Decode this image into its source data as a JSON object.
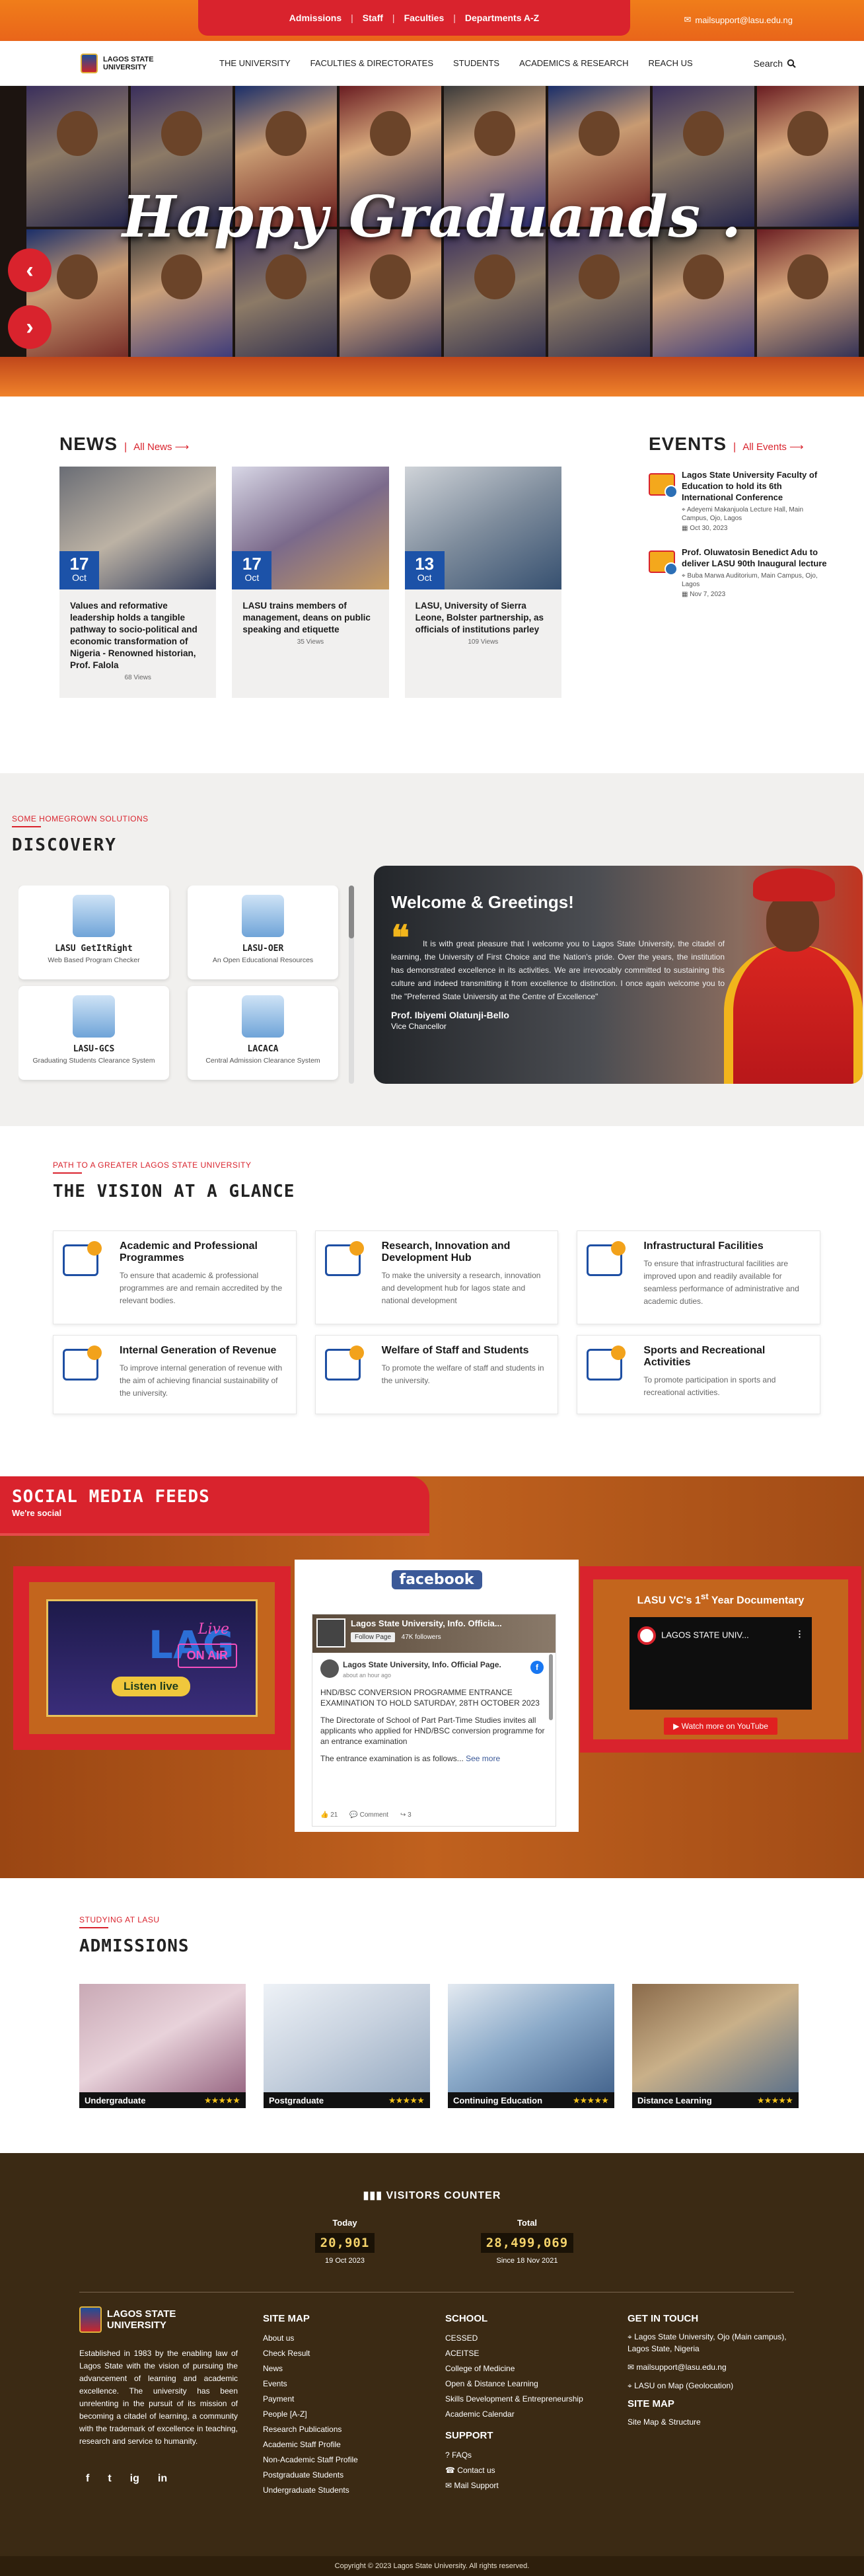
{
  "topbar": {
    "links": [
      "Admissions",
      "Staff",
      "Faculties",
      "Departments A-Z"
    ],
    "email": "mailsupport@lasu.edu.ng"
  },
  "nav": {
    "logo_text": "LAGOS STATE UNIVERSITY",
    "items": [
      "THE UNIVERSITY",
      "FACULTIES & DIRECTORATES",
      "STUDENTS",
      "ACADEMICS & RESEARCH",
      "REACH US"
    ],
    "search_label": "Search"
  },
  "hero": {
    "title": "Happy Graduands .",
    "prev_icon": "chevron-left-icon",
    "next_icon": "chevron-right-icon"
  },
  "news": {
    "heading": "NEWS",
    "all_link": "All News ⟶",
    "items": [
      {
        "day": "17",
        "month": "Oct",
        "title": "Values and reformative leadership holds a tangible pathway to socio-political and economic transformation of Nigeria - Renowned historian, Prof. Falola",
        "views": "68 Views"
      },
      {
        "day": "17",
        "month": "Oct",
        "title": "LASU trains members of management, deans on public speaking and etiquette",
        "views": "35 Views"
      },
      {
        "day": "13",
        "month": "Oct",
        "title": "LASU, University of Sierra Leone, Bolster partnership, as officials of institutions parley",
        "views": "109 Views"
      }
    ]
  },
  "events": {
    "heading": "EVENTS",
    "all_link": "All Events ⟶",
    "items": [
      {
        "title": "Lagos State University Faculty of Education to hold its 6th International Conference",
        "location": "Adeyemi Makanjuola Lecture Hall, Main Campus, Ojo, Lagos",
        "date": "Oct 30, 2023"
      },
      {
        "title": "Prof. Oluwatosin Benedict Adu to deliver LASU 90th Inaugural lecture",
        "location": "Buba Marwa Auditorium, Main Campus, Ojo, Lagos",
        "date": "Nov 7, 2023"
      }
    ]
  },
  "discovery": {
    "kicker": "SOME HOMEGROWN SOLUTIONS",
    "title": "DISCOVERY",
    "tiles": [
      {
        "name": "LASU GetItRight",
        "desc": "Web Based Program Checker"
      },
      {
        "name": "LASU-OER",
        "desc": "An Open Educational Resources"
      },
      {
        "name": "LASU-GCS",
        "desc": "Graduating Students Clearance System"
      },
      {
        "name": "LACACA",
        "desc": "Central Admission Clearance System"
      }
    ]
  },
  "welcome": {
    "title": "Welcome & Greetings!",
    "text": "It is with great pleasure that I welcome you to Lagos State University, the citadel of learning, the University of First Choice and the Nation's pride. Over the years, the institution has demonstrated excellence in its activities. We are irrevocably committed to sustaining this culture and indeed transmitting it from excellence to distinction. I once again welcome you to the \"Preferred State University at the Centre of Excellence\"",
    "name": "Prof. Ibiyemi Olatunji-Bello",
    "role": "Vice Chancellor"
  },
  "vision": {
    "kicker": "PATH TO A GREATER LAGOS STATE UNIVERSITY",
    "title": "THE VISION AT A GLANCE",
    "items": [
      {
        "title": "Academic and Professional Programmes",
        "desc": "To ensure that academic & professional programmes are and remain accredited by the relevant bodies."
      },
      {
        "title": "Research, Innovation and Development Hub",
        "desc": "To make the university a research, innovation and development hub for lagos state and national development"
      },
      {
        "title": "Infrastructural Facilities",
        "desc": "To ensure that infrastructural facilities are improved upon and readily available for seamless performance of administrative and academic duties."
      },
      {
        "title": "Internal Generation of Revenue",
        "desc": "To improve internal generation of revenue with the aim of achieving financial sustainability of the university."
      },
      {
        "title": "Welfare of Staff and Students",
        "desc": "To promote the welfare of staff and students in the university."
      },
      {
        "title": "Sports and Recreational Activities",
        "desc": "To promote participation in sports and recreational activities."
      }
    ]
  },
  "social": {
    "title": "SOCIAL MEDIA FEEDS",
    "subtitle": "We're social",
    "radio": {
      "logo": "LAG",
      "live": "Live",
      "air": "ON AIR",
      "listen": "Listen live"
    },
    "facebook": {
      "brand": "facebook",
      "page": "Lagos State University, Info. Officia...",
      "follow": "Follow Page",
      "followers": "47K followers",
      "post_name": "Lagos State University, Info. Official Page.",
      "post_time": "about an hour ago",
      "post_title": "HND/BSC CONVERSION PROGRAMME ENTRANCE EXAMINATION TO HOLD SATURDAY, 28TH OCTOBER 2023",
      "post_body": "The Directorate of School of Part Part-Time Studies invites all applicants who applied for HND/BSC conversion programme for an entrance examination",
      "post_more": "The entrance examination is as follows...",
      "see_more": "See more",
      "likes": "21",
      "comment": "Comment",
      "shares": "3"
    },
    "youtube": {
      "heading_pre": "LASU VC's 1",
      "heading_sup": "st",
      "heading_post": " Year Documentary",
      "video_title": "LAGOS STATE UNIV...",
      "watch": "Watch more on YouTube"
    }
  },
  "admissions": {
    "kicker": "STUDYING AT LASU",
    "title": "ADMISSIONS",
    "items": [
      {
        "label": "Undergraduate",
        "stars": "★★★★★"
      },
      {
        "label": "Postgraduate",
        "stars": "★★★★★"
      },
      {
        "label": "Continuing Education",
        "stars": "★★★★★"
      },
      {
        "label": "Distance Learning",
        "stars": "★★★★★"
      }
    ]
  },
  "footer": {
    "visitors_heading": "VISITORS COUNTER",
    "today_label": "Today",
    "today_value": "20,901",
    "today_date": "19 Oct 2023",
    "total_label": "Total",
    "total_value": "28,499,069",
    "total_since": "Since 18 Nov 2021",
    "logo_text": "LAGOS STATE UNIVERSITY",
    "about": "Established in 1983 by the enabling law of Lagos State with the vision of pursuing the advancement of learning and academic excellence. The university has been unrelenting in the pursuit of its mission of becoming a citadel of learning, a community with the trademark of excellence in teaching, research and service to humanity.",
    "social_icons": [
      "f",
      "t",
      "ig",
      "in"
    ],
    "sitemap_heading": "SITE MAP",
    "sitemap": [
      "About us",
      "Check Result",
      "News",
      "Events",
      "Payment",
      "People [A-Z]",
      "Research Publications",
      "Academic Staff Profile",
      "Non-Academic Staff Profile",
      "Postgraduate Students",
      "Undergraduate Students"
    ],
    "school_heading": "SCHOOL",
    "school": [
      "CESSED",
      "ACEITSE",
      "College of Medicine",
      "Open & Distance Learning",
      "Skills Development & Entrepreneurship",
      "Academic Calendar"
    ],
    "support_heading": "SUPPORT",
    "support": [
      "FAQs",
      "Contact us",
      "Mail Support"
    ],
    "git_heading": "GET IN TOUCH",
    "address": "Lagos State University, Ojo (Main campus), Lagos State, Nigeria",
    "email": "mailsupport@lasu.edu.ng",
    "map_link": "LASU on Map (Geolocation)",
    "sitemap2_heading": "SITE MAP",
    "sitemap2_link": "Site Map & Structure",
    "copyright": "Copyright © 2023 Lagos State University. All rights reserved."
  }
}
